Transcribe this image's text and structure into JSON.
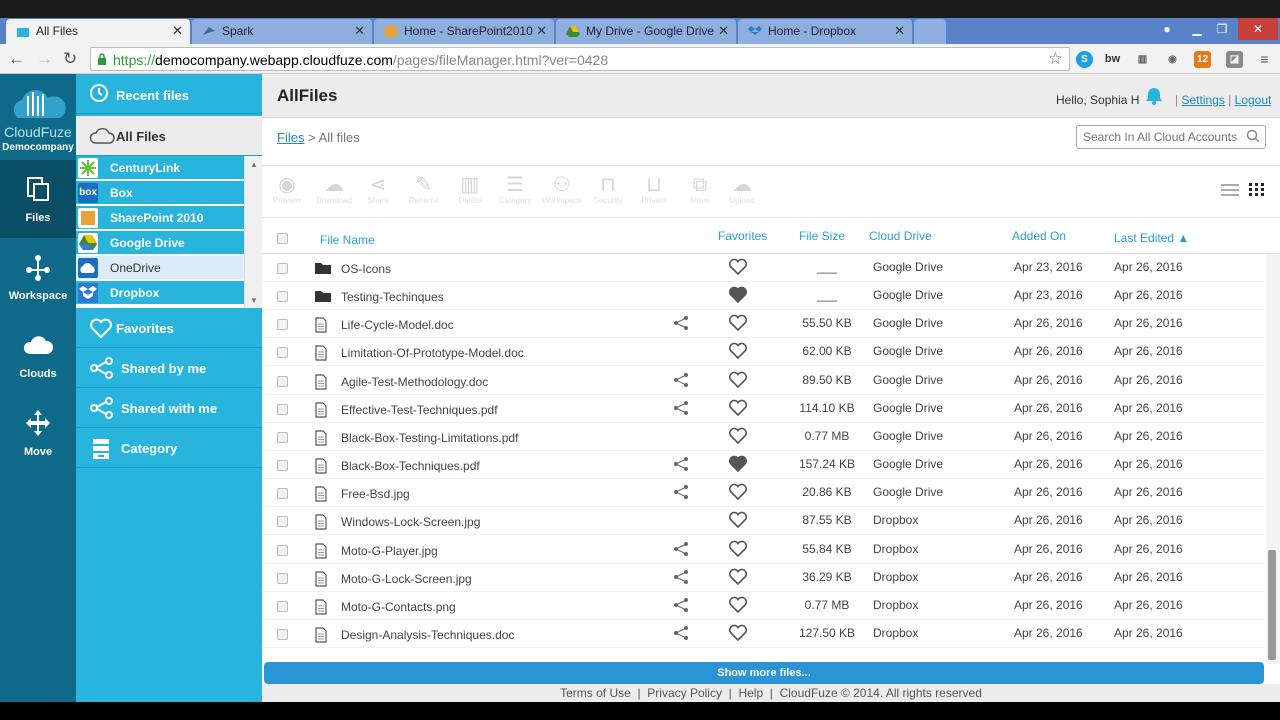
{
  "browser": {
    "tabs": [
      {
        "label": "All Files",
        "active": true
      },
      {
        "label": "Spark",
        "active": false
      },
      {
        "label": "Home - SharePoint2010",
        "active": false
      },
      {
        "label": "My Drive - Google Drive",
        "active": false
      },
      {
        "label": "Home - Dropbox",
        "active": false
      }
    ],
    "url_scheme": "https://",
    "url_host": "democompany.webapp.cloudfuze.com",
    "url_path": "/pages/fileManager.html?ver=0428",
    "ext_badge": "12"
  },
  "brand": {
    "name": "CloudFuze",
    "company": "Democompany"
  },
  "leftnav": {
    "items": [
      {
        "label": "Files",
        "icon": "files-icon"
      },
      {
        "label": "Workspace",
        "icon": "workspace-icon"
      },
      {
        "label": "Clouds",
        "icon": "clouds-icon"
      },
      {
        "label": "Move",
        "icon": "move-icon"
      }
    ]
  },
  "sidebar": {
    "recent": "Recent files",
    "all_files": "All Files",
    "clouds": [
      "CenturyLink",
      "Box",
      "SharePoint 2010",
      "Google Drive",
      "OneDrive",
      "Dropbox"
    ],
    "favorites": "Favorites",
    "shared_by_me": "Shared by me",
    "shared_with_me": "Shared with me",
    "category": "Category"
  },
  "header": {
    "title": "AllFiles",
    "hello": "Hello, Sophia H",
    "settings": "Settings",
    "logout": "Logout",
    "sep": "|"
  },
  "crumb": {
    "root": "Files",
    "sep": ">",
    "current": "All files"
  },
  "search": {
    "placeholder": "Search In All Cloud Accounts"
  },
  "toolbar": [
    "Preview",
    "Download",
    "Share",
    "Rename",
    "Delete",
    "Category",
    "Workspace",
    "Security",
    "Private",
    "Move",
    "Upload"
  ],
  "table": {
    "headers": {
      "name": "File Name",
      "favorites": "Favorites",
      "size": "File Size",
      "drive": "Cloud Drive",
      "added": "Added On",
      "edited": "Last Edited ▲"
    },
    "rows": [
      {
        "name": "OS-Icons",
        "type": "folder",
        "shared": false,
        "fav": false,
        "size": "___",
        "drive": "Google Drive",
        "added": "Apr 23, 2016",
        "edited": "Apr 26, 2016"
      },
      {
        "name": "Testing-Techinques",
        "type": "folder",
        "shared": false,
        "fav": true,
        "size": "___",
        "drive": "Google Drive",
        "added": "Apr 23, 2016",
        "edited": "Apr 26, 2016"
      },
      {
        "name": "Life-Cycle-Model.doc",
        "type": "file",
        "shared": true,
        "fav": false,
        "size": "55.50 KB",
        "drive": "Google Drive",
        "added": "Apr 26, 2016",
        "edited": "Apr 26, 2016"
      },
      {
        "name": "Limitation-Of-Prototype-Model.doc",
        "type": "file",
        "shared": false,
        "fav": false,
        "size": "62.00 KB",
        "drive": "Google Drive",
        "added": "Apr 26, 2016",
        "edited": "Apr 26, 2016"
      },
      {
        "name": "Agile-Test-Methodology.doc",
        "type": "file",
        "shared": true,
        "fav": false,
        "size": "89.50 KB",
        "drive": "Google Drive",
        "added": "Apr 26, 2016",
        "edited": "Apr 26, 2016"
      },
      {
        "name": "Effective-Test-Techniques.pdf",
        "type": "file",
        "shared": true,
        "fav": false,
        "size": "114.10 KB",
        "drive": "Google Drive",
        "added": "Apr 26, 2016",
        "edited": "Apr 26, 2016"
      },
      {
        "name": "Black-Box-Testing-Limitations.pdf",
        "type": "file",
        "shared": false,
        "fav": false,
        "size": "0.77 MB",
        "drive": "Google Drive",
        "added": "Apr 26, 2016",
        "edited": "Apr 26, 2016"
      },
      {
        "name": "Black-Box-Techniques.pdf",
        "type": "file",
        "shared": true,
        "fav": true,
        "size": "157.24 KB",
        "drive": "Google Drive",
        "added": "Apr 26, 2016",
        "edited": "Apr 26, 2016"
      },
      {
        "name": "Free-Bsd.jpg",
        "type": "file",
        "shared": true,
        "fav": false,
        "size": "20.86 KB",
        "drive": "Google Drive",
        "added": "Apr 26, 2016",
        "edited": "Apr 26, 2016"
      },
      {
        "name": "Windows-Lock-Screen.jpg",
        "type": "file",
        "shared": false,
        "fav": false,
        "size": "87.55 KB",
        "drive": "Dropbox",
        "added": "Apr 26, 2016",
        "edited": "Apr 26, 2016"
      },
      {
        "name": "Moto-G-Player.jpg",
        "type": "file",
        "shared": true,
        "fav": false,
        "size": "55.84 KB",
        "drive": "Dropbox",
        "added": "Apr 26, 2016",
        "edited": "Apr 26, 2016"
      },
      {
        "name": "Moto-G-Lock-Screen.jpg",
        "type": "file",
        "shared": true,
        "fav": false,
        "size": "36.29 KB",
        "drive": "Dropbox",
        "added": "Apr 26, 2016",
        "edited": "Apr 26, 2016"
      },
      {
        "name": "Moto-G-Contacts.png",
        "type": "file",
        "shared": true,
        "fav": false,
        "size": "0.77 MB",
        "drive": "Dropbox",
        "added": "Apr 26, 2016",
        "edited": "Apr 26, 2016"
      },
      {
        "name": "Design-Analysis-Techniques.doc",
        "type": "file",
        "shared": true,
        "fav": false,
        "size": "127.50 KB",
        "drive": "Dropbox",
        "added": "Apr 26, 2016",
        "edited": "Apr 26, 2016"
      }
    ]
  },
  "show_more": "Show more files...",
  "footer": {
    "terms": "Terms of Use",
    "privacy": "Privacy Policy",
    "help": "Help",
    "copyright": "CloudFuze © 2014. All rights reserved",
    "sep": "|"
  },
  "colors": {
    "accent": "#28b4dc",
    "nav": "#0e6a88",
    "link": "#1a8ac0",
    "button": "#2a94d6"
  }
}
